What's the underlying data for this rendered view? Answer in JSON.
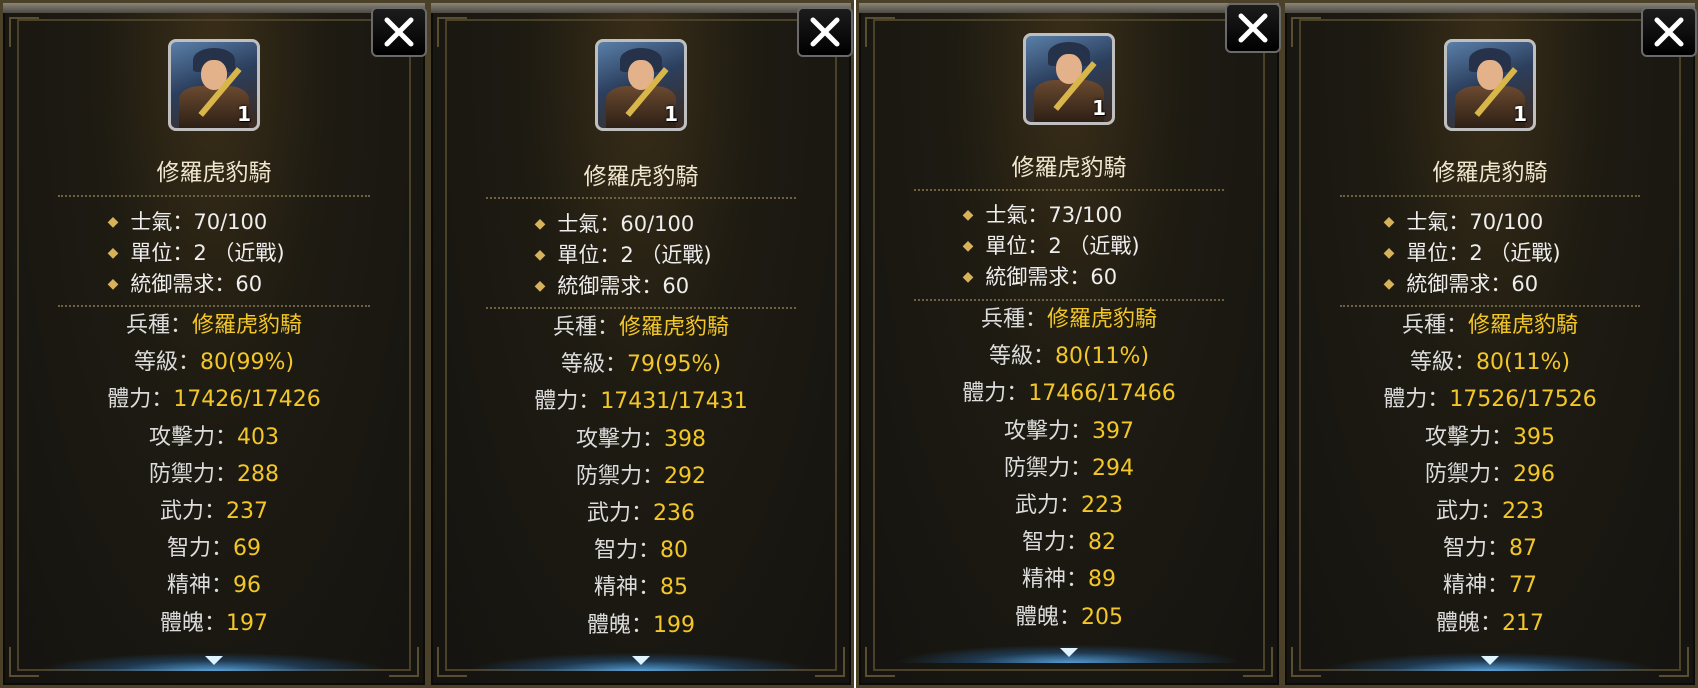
{
  "panels": [
    {
      "portrait_level": "1",
      "name": "修羅虎豹騎",
      "morale": "士氣：70/100",
      "unit": "單位：2 （近戰)",
      "command": "統御需求：60",
      "stats": [
        {
          "label": "兵種：",
          "value": "修羅虎豹騎"
        },
        {
          "label": "等級：",
          "value": "80(99%)"
        },
        {
          "label": "體力：",
          "value": "17426/17426"
        },
        {
          "label": "攻擊力：",
          "value": "403"
        },
        {
          "label": "防禦力：",
          "value": "288"
        },
        {
          "label": "武力：",
          "value": "237"
        },
        {
          "label": "智力：",
          "value": "69"
        },
        {
          "label": "精神：",
          "value": "96"
        },
        {
          "label": "體魄：",
          "value": "197"
        }
      ]
    },
    {
      "portrait_level": "1",
      "name": "修羅虎豹騎",
      "morale": "士氣：60/100",
      "unit": "單位：2 （近戰)",
      "command": "統御需求：60",
      "stats": [
        {
          "label": "兵種：",
          "value": "修羅虎豹騎"
        },
        {
          "label": "等級：",
          "value": "79(95%)"
        },
        {
          "label": "體力：",
          "value": "17431/17431"
        },
        {
          "label": "攻擊力：",
          "value": "398"
        },
        {
          "label": "防禦力：",
          "value": "292"
        },
        {
          "label": "武力：",
          "value": "236"
        },
        {
          "label": "智力：",
          "value": "80"
        },
        {
          "label": "精神：",
          "value": "85"
        },
        {
          "label": "體魄：",
          "value": "199"
        }
      ]
    },
    {
      "portrait_level": "1",
      "name": "修羅虎豹騎",
      "morale": "士氣：73/100",
      "unit": "單位：2 （近戰)",
      "command": "統御需求：60",
      "stats": [
        {
          "label": "兵種：",
          "value": "修羅虎豹騎"
        },
        {
          "label": "等級：",
          "value": "80(11%)"
        },
        {
          "label": "體力：",
          "value": "17466/17466"
        },
        {
          "label": "攻擊力：",
          "value": "397"
        },
        {
          "label": "防禦力：",
          "value": "294"
        },
        {
          "label": "武力：",
          "value": "223"
        },
        {
          "label": "智力：",
          "value": "82"
        },
        {
          "label": "精神：",
          "value": "89"
        },
        {
          "label": "體魄：",
          "value": "205"
        }
      ]
    },
    {
      "portrait_level": "1",
      "name": "修羅虎豹騎",
      "morale": "士氣：70/100",
      "unit": "單位：2 （近戰)",
      "command": "統御需求：60",
      "stats": [
        {
          "label": "兵種：",
          "value": "修羅虎豹騎"
        },
        {
          "label": "等級：",
          "value": "80(11%)"
        },
        {
          "label": "體力：",
          "value": "17526/17526"
        },
        {
          "label": "攻擊力：",
          "value": "395"
        },
        {
          "label": "防禦力：",
          "value": "296"
        },
        {
          "label": "武力：",
          "value": "223"
        },
        {
          "label": "智力：",
          "value": "87"
        },
        {
          "label": "精神：",
          "value": "77"
        },
        {
          "label": "體魄：",
          "value": "217"
        }
      ]
    }
  ],
  "icons": {
    "close": "close-icon",
    "scroll_down": "chevron-down-icon",
    "bullet": "diamond-bullet-icon"
  },
  "colors": {
    "value_text": "#f3c728",
    "label_text": "#dcdcdc",
    "name_text": "#f1e7cf",
    "panel_bg": "#141310"
  }
}
